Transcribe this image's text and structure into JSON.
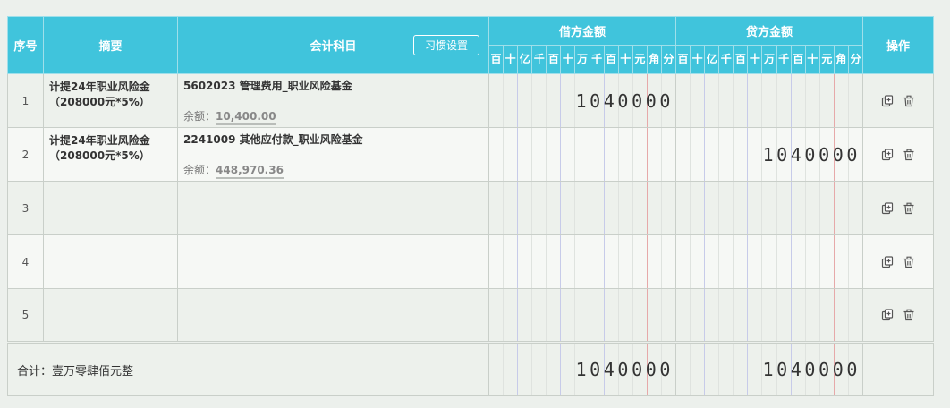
{
  "header": {
    "seq": "序号",
    "summary": "摘要",
    "account": "会计科目",
    "habit_button": "习惯设置",
    "debit": "借方金额",
    "credit": "贷方金额",
    "ops": "操作",
    "digits": [
      "百",
      "十",
      "亿",
      "千",
      "百",
      "十",
      "万",
      "千",
      "百",
      "十",
      "元",
      "角",
      "分"
    ]
  },
  "rows": [
    {
      "seq": "1",
      "summary": "计提24年职业风险金（208000元*5%）",
      "account": "5602023 管理费用_职业风险基金",
      "balance_label": "余额：",
      "balance": "10,400.00",
      "debit": "1040000",
      "credit": ""
    },
    {
      "seq": "2",
      "summary": "计提24年职业风险金（208000元*5%）",
      "account": "2241009 其他应付款_职业风险基金",
      "balance_label": "余额：",
      "balance": "448,970.36",
      "debit": "",
      "credit": "1040000"
    },
    {
      "seq": "3",
      "summary": "",
      "account": "",
      "balance_label": "",
      "balance": "",
      "debit": "",
      "credit": ""
    },
    {
      "seq": "4",
      "summary": "",
      "account": "",
      "balance_label": "",
      "balance": "",
      "debit": "",
      "credit": ""
    },
    {
      "seq": "5",
      "summary": "",
      "account": "",
      "balance_label": "",
      "balance": "",
      "debit": "",
      "credit": ""
    }
  ],
  "total": {
    "label": "合计：壹万零肆佰元整",
    "debit": "1040000",
    "credit": "1040000"
  },
  "icons": {
    "copy": "copy-icon",
    "delete": "trash-icon"
  }
}
